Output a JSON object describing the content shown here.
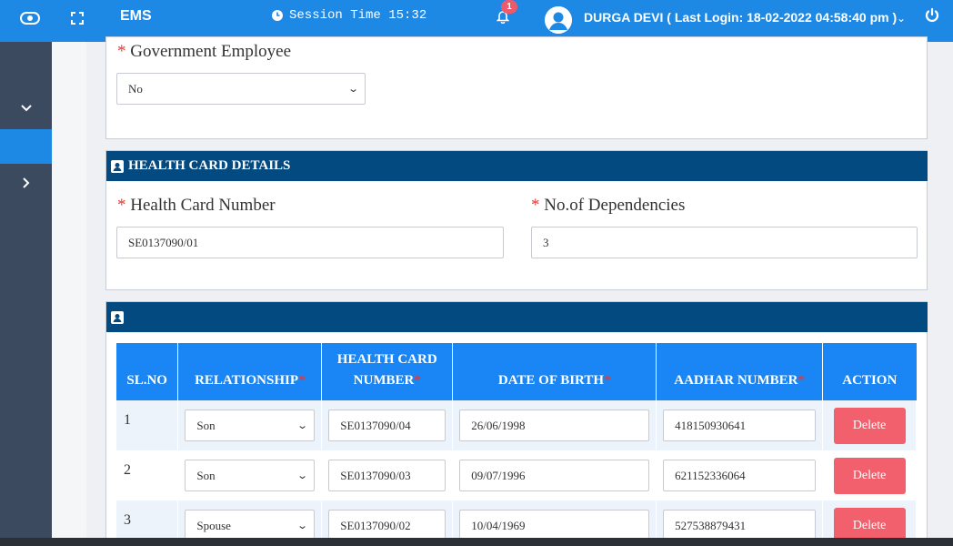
{
  "topbar": {
    "app_name": "EMS",
    "session_label": "Session Time 15:32",
    "notification_count": "1",
    "user_label": "DURGA DEVI ( Last Login: 18-02-2022 04:58:40 pm )"
  },
  "colors": {
    "topbar": "#1e88e5",
    "sidebar": "#3b4a5e",
    "section_header": "#034a80",
    "table_header": "#1a86f5",
    "delete_button": "#f2606d"
  },
  "government_section": {
    "label": "Government Employee",
    "value": "No"
  },
  "health_card_section": {
    "title": "HEALTH CARD DETAILS",
    "card_number_label": "Health Card Number",
    "card_number_value": "SE0137090/01",
    "dependencies_label": "No.of Dependencies",
    "dependencies_value": "3"
  },
  "dependents_table": {
    "columns": {
      "slno": "SL.NO",
      "relationship": "RELATIONSHIP",
      "health_card_line1": "HEALTH CARD",
      "health_card_line2": "NUMBER",
      "dob": "DATE OF BIRTH",
      "aadhar": "AADHAR NUMBER",
      "action": "ACTION"
    },
    "rows": [
      {
        "slno": "1",
        "relationship": "Son",
        "health_card": "SE0137090/04",
        "dob": "26/06/1998",
        "aadhar": "418150930641",
        "action": "Delete"
      },
      {
        "slno": "2",
        "relationship": "Son",
        "health_card": "SE0137090/03",
        "dob": "09/07/1996",
        "aadhar": "621152336064",
        "action": "Delete"
      },
      {
        "slno": "3",
        "relationship": "Spouse",
        "health_card": "SE0137090/02",
        "dob": "10/04/1969",
        "aadhar": "527538879431",
        "action": "Delete"
      }
    ]
  }
}
